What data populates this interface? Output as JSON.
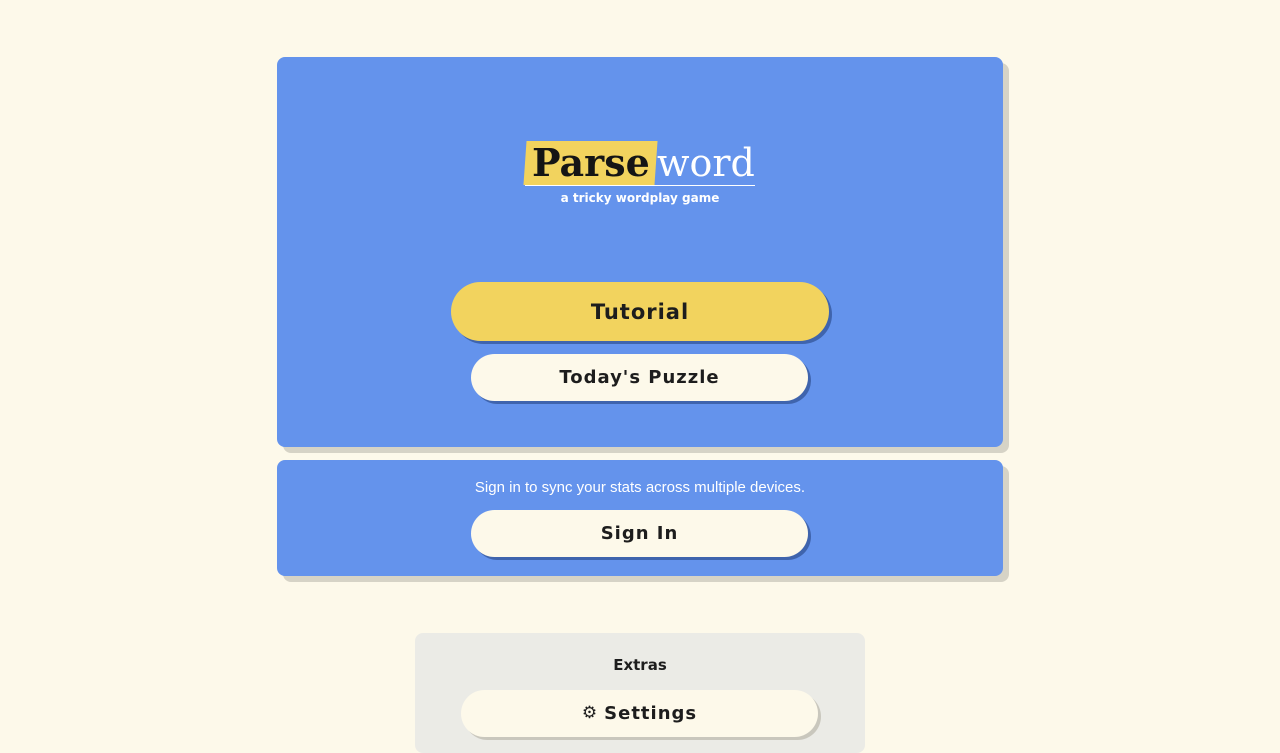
{
  "logo": {
    "highlight": "Parse",
    "rest": "word"
  },
  "tagline": "a tricky wordplay game",
  "buttons": {
    "tutorial": "Tutorial",
    "puzzle": "Today's Puzzle",
    "signin": "Sign In",
    "settings": "Settings"
  },
  "signin_prompt": "Sign in to sync your stats across multiple devices.",
  "extras": {
    "title": "Extras"
  },
  "icons": {
    "settings": "gear-icon"
  },
  "colors": {
    "background": "#fdf9ea",
    "card_blue": "#6493ec",
    "accent_yellow": "#f2d35e",
    "extras_gray": "#ebebe6"
  }
}
